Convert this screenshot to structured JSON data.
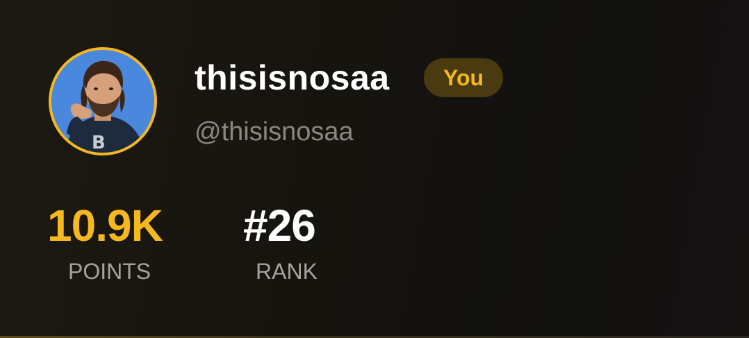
{
  "profile": {
    "username": "thisisnosaa",
    "badge": "You",
    "handle": "@thisisnosaa",
    "avatar_icon": "user-avatar-photo"
  },
  "stats": {
    "points_value": "10.9K",
    "points_label": "POINTS",
    "rank_value": "#26",
    "rank_label": "RANK"
  },
  "colors": {
    "accent": "#f5b81f",
    "badge_bg": "#4a3a10",
    "background": "#16140f",
    "muted_text": "#8a8782"
  }
}
